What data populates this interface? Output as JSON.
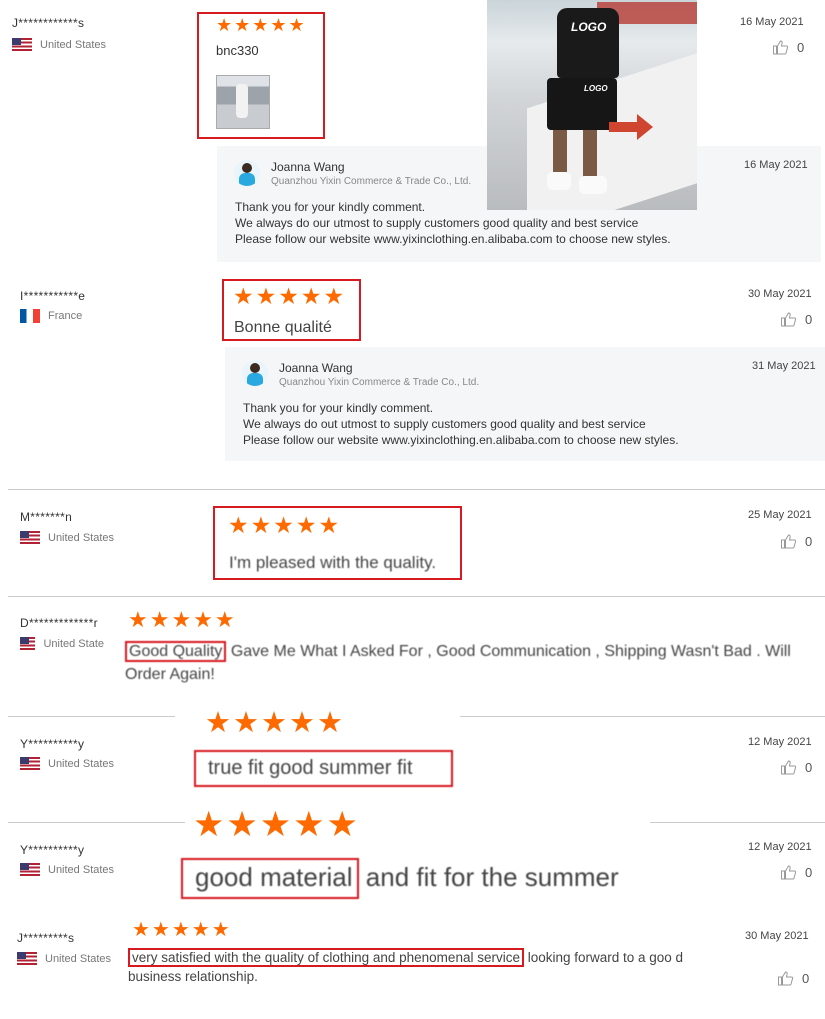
{
  "reviews": [
    {
      "name": "J************s",
      "country": "United States",
      "flag": "us",
      "date": "16 May 2021",
      "likes": "0",
      "stars": "★★★★★",
      "text": "bnc330"
    },
    {
      "name": "I***********e",
      "country": "France",
      "flag": "fr",
      "date": "30 May 2021",
      "likes": "0",
      "stars": "★★★★★",
      "text": "Bonne qualité"
    },
    {
      "name": "M*******n",
      "country": "United States",
      "flag": "us",
      "date": "25 May 2021",
      "likes": "0",
      "stars": "★★★★★",
      "text": "I'm pleased with the quality."
    },
    {
      "name": "D*************r",
      "country": "United State",
      "flag": "us",
      "stars": "★★★★★",
      "highlight": "Good Quality",
      "text": " Gave Me What I Asked For , Good Communication , Shipping Wasn't Bad . Will Order Again!"
    },
    {
      "name": "Y**********y",
      "country": "United States",
      "flag": "us",
      "date": "12 May 2021",
      "likes": "0",
      "stars": "★★★★★",
      "text": "true fit good summer fit"
    },
    {
      "name": "Y**********y",
      "country": "United States",
      "flag": "us",
      "date": "12 May 2021",
      "likes": "0",
      "stars": "★★★★★",
      "highlight": "good material",
      "text": " and fit for the summer"
    },
    {
      "name": "J*********s",
      "country": "United States",
      "flag": "us",
      "date": "30 May 2021",
      "likes": "0",
      "stars": "★★★★★",
      "highlight": "very satisfied with the quality of clothing and phenomenal service",
      "text": " looking forward to a goo d business relationship."
    }
  ],
  "replies": [
    {
      "name": "Joanna Wang",
      "company": "Quanzhou Yixin Commerce & Trade Co., Ltd.",
      "date": "16 May 2021",
      "line1": "Thank you for your kindly comment.",
      "line2": "We always do our utmost to supply customers good quality and best service",
      "line3": "Please follow our website  www.yixinclothing.en.alibaba.com to choose new styles."
    },
    {
      "name": "Joanna Wang",
      "company": "Quanzhou Yixin Commerce & Trade Co., Ltd.",
      "date": "31 May 2021",
      "line1": "Thank you for your kindly comment.",
      "line2": "We always do out utmost to supply customers good quality and best service",
      "line3": "Please follow our website  www.yixinclothing.en.alibaba.com to choose new styles."
    }
  ],
  "product_photo": {
    "shirt_logo": "LOGO",
    "shorts_logo": "LOGO"
  }
}
